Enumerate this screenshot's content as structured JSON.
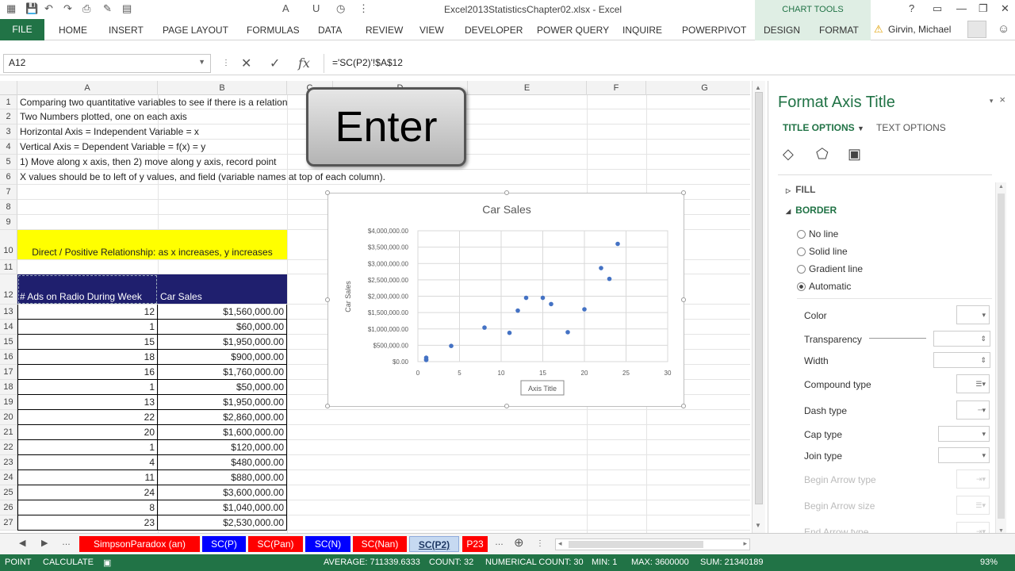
{
  "window": {
    "title": "Excel2013StatisticsChapter02.xlsx - Excel",
    "chart_tools": "CHART TOOLS",
    "help": "?",
    "user": "Girvin, Michael"
  },
  "ribbon": {
    "file": "FILE",
    "tabs": [
      "HOME",
      "INSERT",
      "PAGE LAYOUT",
      "FORMULAS",
      "DATA",
      "REVIEW",
      "VIEW",
      "DEVELOPER",
      "POWER QUERY",
      "INQUIRE",
      "POWERPIVOT",
      "DESIGN",
      "FORMAT"
    ]
  },
  "formula_bar": {
    "name_box": "A12",
    "fx": "fx",
    "formula": "='SC(P2)'!$A$12"
  },
  "columns": [
    "A",
    "B",
    "C",
    "D",
    "E",
    "F",
    "G"
  ],
  "rows": [
    "1",
    "2",
    "3",
    "4",
    "5",
    "6",
    "7",
    "8",
    "9",
    "10",
    "11",
    "12",
    "13",
    "14",
    "15",
    "16",
    "17",
    "18",
    "19",
    "20",
    "21",
    "22",
    "23",
    "24",
    "25",
    "26",
    "27"
  ],
  "notes": [
    "Comparing two quantitative variables to see if there is a relation",
    "Two Numbers plotted, one on each axis",
    "Horizontal Axis = Independent Variable = x",
    "Vertical Axis = Dependent Variable = f(x) = y",
    "1) Move along x axis, then 2) move along y axis, record point",
    "X values should be to left of y values, and field (variable names at top of each column)."
  ],
  "highlight": "Direct / Positive Relationship: as x increases, y increases",
  "table": {
    "header_x": "# Ads on Radio During Week",
    "header_y": "Car Sales",
    "x": [
      "12",
      "1",
      "15",
      "18",
      "16",
      "1",
      "13",
      "22",
      "20",
      "1",
      "4",
      "11",
      "24",
      "8",
      "23"
    ],
    "y": [
      "$1,560,000.00",
      "$60,000.00",
      "$1,950,000.00",
      "$900,000.00",
      "$1,760,000.00",
      "$50,000.00",
      "$1,950,000.00",
      "$2,860,000.00",
      "$1,600,000.00",
      "$120,000.00",
      "$480,000.00",
      "$880,000.00",
      "$3,600,000.00",
      "$1,040,000.00",
      "$2,530,000.00"
    ]
  },
  "overlay_key": "Enter",
  "chart_data": {
    "type": "scatter",
    "title": "Car Sales",
    "xlabel": "Axis Title",
    "ylabel": "Car Sales",
    "xlim": [
      0,
      30
    ],
    "ylim": [
      0,
      4000000
    ],
    "x_ticks": [
      "0",
      "5",
      "10",
      "15",
      "20",
      "25",
      "30"
    ],
    "y_ticks": [
      "$0.00",
      "$500,000.00",
      "$1,000,000.00",
      "$1,500,000.00",
      "$2,000,000.00",
      "$2,500,000.00",
      "$3,000,000.00",
      "$3,500,000.00",
      "$4,000,000.00"
    ],
    "grid": true,
    "point_color": "#4472c4",
    "series": [
      {
        "x": [
          12,
          1,
          15,
          18,
          16,
          1,
          13,
          22,
          20,
          1,
          4,
          11,
          24,
          8,
          23
        ],
        "y": [
          1560000,
          60000,
          1950000,
          900000,
          1760000,
          50000,
          1950000,
          2860000,
          1600000,
          120000,
          480000,
          880000,
          3600000,
          1040000,
          2530000
        ]
      }
    ]
  },
  "pane": {
    "title": "Format Axis Title",
    "close": "×",
    "tab_title": "TITLE OPTIONS",
    "tab_text": "TEXT OPTIONS",
    "fill": "FILL",
    "border": "BORDER",
    "radios": [
      "No line",
      "Solid line",
      "Gradient line",
      "Automatic"
    ],
    "props": [
      "Color",
      "Transparency",
      "Width",
      "Compound type",
      "Dash type",
      "Cap type",
      "Join type",
      "Begin Arrow type",
      "Begin Arrow size",
      "End Arrow type"
    ]
  },
  "sheet_tabs": [
    "SimpsonParadox (an)",
    "SC(P)",
    "SC(Pan)",
    "SC(N)",
    "SC(Nan)",
    "SC(P2)",
    "P23"
  ],
  "sheet_tab_colors": [
    "#ff0000",
    "#0000ff",
    "#ff0000",
    "#0000ff",
    "#ff0000",
    "#c6d9f1",
    "#ff0000"
  ],
  "status": {
    "mode": "POINT",
    "calc": "CALCULATE",
    "average": "AVERAGE: 711339.6333",
    "count": "COUNT: 32",
    "numerical_count": "NUMERICAL COUNT: 30",
    "min": "MIN: 1",
    "max": "MAX: 3600000",
    "sum": "SUM: 21340189",
    "zoom": "93%"
  }
}
